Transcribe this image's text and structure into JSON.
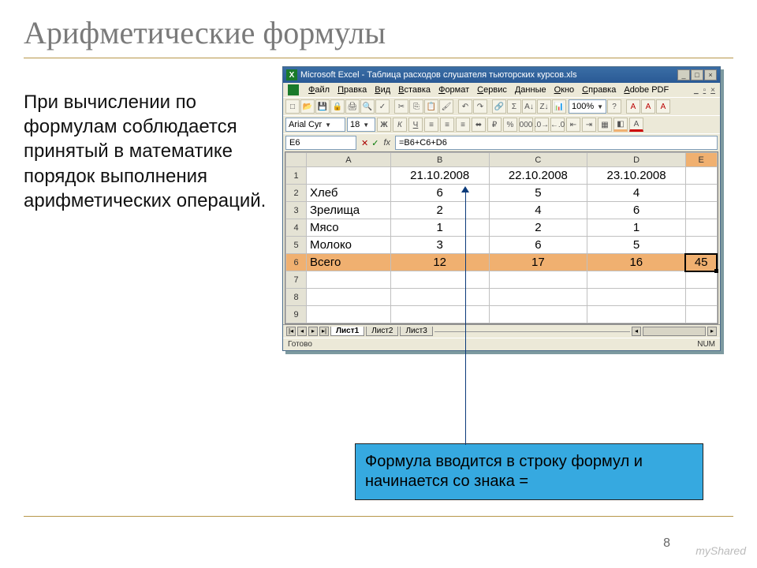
{
  "slide": {
    "title": "Арифметические формулы",
    "body": "При вычислении по формулам соблюдается принятый в математике порядок выполнения арифметических операций.",
    "callout": "Формула вводится в строку формул и начинается со знака =",
    "pagenum": "8",
    "watermark": "myShared"
  },
  "excel": {
    "title": "Microsoft Excel - Таблица расходов слушателя тьюторских курсов.xls",
    "menu": [
      "Файл",
      "Правка",
      "Вид",
      "Вставка",
      "Формат",
      "Сервис",
      "Данные",
      "Окно",
      "Справка",
      "Adobe PDF"
    ],
    "font_name": "Arial Cyr",
    "font_size": "18",
    "zoom": "100%",
    "name_box": "E6",
    "formula": "=B6+C6+D6",
    "columns": [
      "",
      "A",
      "B",
      "C",
      "D",
      "E"
    ],
    "rows": [
      {
        "n": "1",
        "cells": [
          "",
          "21.10.2008",
          "22.10.2008",
          "23.10.2008",
          ""
        ]
      },
      {
        "n": "2",
        "cells": [
          "Хлеб",
          "6",
          "5",
          "4",
          ""
        ]
      },
      {
        "n": "3",
        "cells": [
          "Зрелища",
          "2",
          "4",
          "6",
          ""
        ]
      },
      {
        "n": "4",
        "cells": [
          "Мясо",
          "1",
          "2",
          "1",
          ""
        ]
      },
      {
        "n": "5",
        "cells": [
          "Молоко",
          "3",
          "6",
          "5",
          ""
        ]
      },
      {
        "n": "6",
        "cells": [
          "Всего",
          "12",
          "17",
          "16",
          "45"
        ],
        "total": true
      },
      {
        "n": "7",
        "cells": [
          "",
          "",
          "",
          "",
          ""
        ]
      },
      {
        "n": "8",
        "cells": [
          "",
          "",
          "",
          "",
          ""
        ]
      },
      {
        "n": "9",
        "cells": [
          "",
          "",
          "",
          "",
          ""
        ]
      }
    ],
    "tabs": [
      "Лист1",
      "Лист2",
      "Лист3"
    ],
    "status_left": "Готово",
    "status_right": "NUM"
  }
}
